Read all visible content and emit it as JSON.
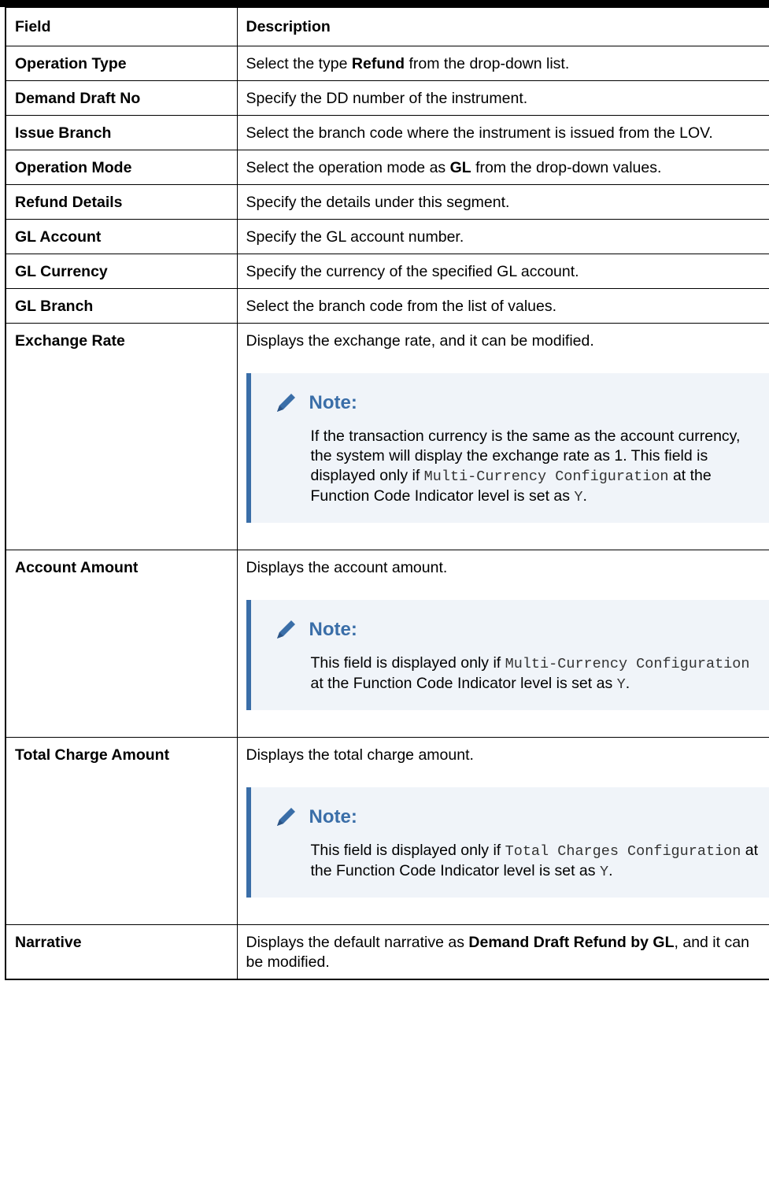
{
  "header": {
    "field": "Field",
    "description": "Description"
  },
  "rows": [
    {
      "field": "Operation Type",
      "desc": {
        "a": "Select the type ",
        "b": "Refund",
        "c": " from the drop-down list."
      }
    },
    {
      "field": "Demand Draft No",
      "desc": {
        "a": "Specify the DD number of the instrument."
      }
    },
    {
      "field": "Issue Branch",
      "desc": {
        "a": "Select the branch code where the instrument is issued from the LOV."
      }
    },
    {
      "field": "Operation Mode",
      "desc": {
        "a": "Select the operation mode as ",
        "b": "GL",
        "c": " from the drop-down values."
      }
    },
    {
      "field": "Refund Details",
      "desc": {
        "a": "Specify the details under this segment."
      }
    },
    {
      "field": "GL Account",
      "desc": {
        "a": "Specify the GL account number."
      }
    },
    {
      "field": "GL Currency",
      "desc": {
        "a": "Specify the currency of the specified GL account."
      }
    },
    {
      "field": "GL Branch",
      "desc": {
        "a": "Select the branch code from the list of values."
      }
    },
    {
      "field": "Exchange Rate",
      "desc": {
        "a": "Displays the exchange rate, and it can be modified."
      },
      "note": {
        "title": "Note:",
        "t1": "If the transaction currency is the same as the account currency, the system will display the exchange rate as 1. This field is displayed only if ",
        "code1": "Multi-Currency Configuration",
        "t2": " at the Function Code Indicator level is set as ",
        "code2": "Y",
        "t3": "."
      }
    },
    {
      "field": "Account Amount",
      "desc": {
        "a": "Displays the account amount."
      },
      "note": {
        "title": "Note:",
        "t1": "This field is displayed only if ",
        "code1": "Multi-Currency Configuration",
        "t2": " at the Function Code Indicator level is set as ",
        "code2": "Y",
        "t3": "."
      }
    },
    {
      "field": "Total Charge Amount",
      "desc": {
        "a": "Displays the total charge amount."
      },
      "note": {
        "title": "Note:",
        "t1": "This field is displayed only if ",
        "code1": "Total Charges Configuration",
        "t2": " at the Function Code Indicator level is set as ",
        "code2": "Y",
        "t3": "."
      }
    },
    {
      "field": "Narrative",
      "desc": {
        "a": "Displays the default narrative as ",
        "b": "Demand Draft Refund by GL",
        "c": ", and it can be modified."
      }
    }
  ],
  "colors": {
    "note_accent": "#3a6ea8",
    "note_bg": "#f0f4f9"
  },
  "icons": {
    "note": "pencil-icon"
  }
}
